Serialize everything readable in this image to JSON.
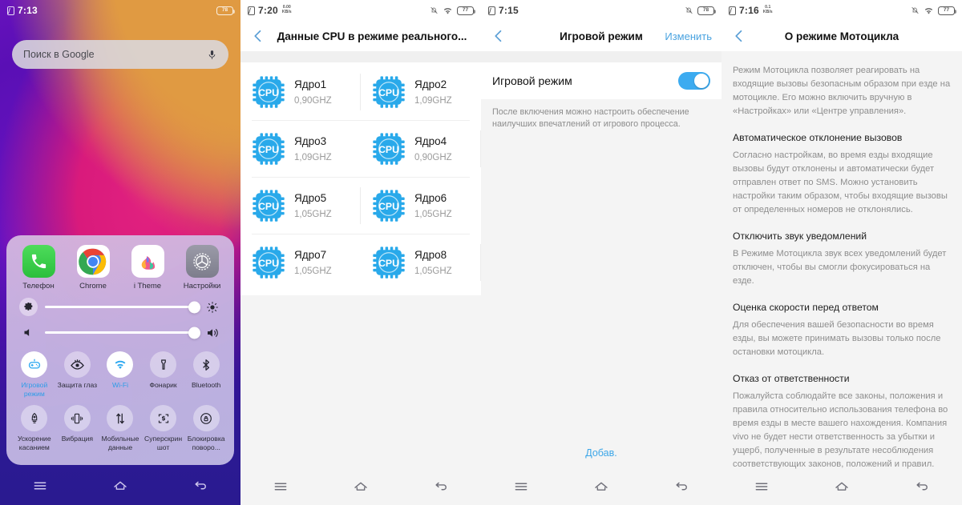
{
  "screens": {
    "home": {
      "status": {
        "time": "7:13",
        "battery": "78",
        "sim_icon": "sim-card-icon",
        "battery_icon": "battery-icon"
      },
      "search": {
        "placeholder": "Поиск в Google",
        "mic_icon": "microphone-icon"
      },
      "control_center": {
        "apps": [
          {
            "label": "Телефон",
            "icon": "phone-app-icon"
          },
          {
            "label": "Chrome",
            "icon": "chrome-app-icon"
          },
          {
            "label": "i Theme",
            "icon": "itheme-app-icon"
          },
          {
            "label": "Настройки",
            "icon": "settings-app-icon"
          }
        ],
        "brightness": {
          "left_icon": "gear-icon",
          "right_icon": "brightness-icon",
          "value": "95"
        },
        "volume": {
          "left_icon": "volume-low-icon",
          "right_icon": "volume-high-icon",
          "value": "95"
        },
        "tiles": [
          {
            "label": "Игровой режим",
            "icon": "game-mode-icon",
            "active": true
          },
          {
            "label": "Защита глаз",
            "icon": "eye-protection-icon",
            "active": false
          },
          {
            "label": "Wi-Fi",
            "icon": "wifi-icon",
            "active": true
          },
          {
            "label": "Фонарик",
            "icon": "flashlight-icon",
            "active": false
          },
          {
            "label": "Bluetooth",
            "icon": "bluetooth-icon",
            "active": false
          },
          {
            "label": "Ускорение касанием",
            "icon": "touch-boost-icon",
            "active": false
          },
          {
            "label": "Вибрация",
            "icon": "vibration-icon",
            "active": false
          },
          {
            "label": "Мобильные данные",
            "icon": "mobile-data-icon",
            "active": false
          },
          {
            "label": "Суперскриншот",
            "icon": "super-screenshot-icon",
            "active": false
          },
          {
            "label": "Блокировка поворо...",
            "icon": "rotation-lock-icon",
            "active": false
          }
        ]
      },
      "navbar": {
        "recents_icon": "menu-icon",
        "home_icon": "home-icon",
        "back_icon": "back-icon"
      }
    },
    "cpu": {
      "status": {
        "time": "7:20",
        "netspeed_value": "0.00",
        "netspeed_unit": "KB/s",
        "battery": "77"
      },
      "appbar": {
        "title": "Данные CPU в режиме реального...",
        "back_icon": "back-chevron-icon"
      },
      "cores": [
        {
          "name": "Ядро1",
          "freq": "0,90GHZ"
        },
        {
          "name": "Ядро2",
          "freq": "1,09GHZ"
        },
        {
          "name": "Ядро3",
          "freq": "1,09GHZ"
        },
        {
          "name": "Ядро4",
          "freq": "0,90GHZ"
        },
        {
          "name": "Ядро5",
          "freq": "1,05GHZ"
        },
        {
          "name": "Ядро6",
          "freq": "1,05GHZ"
        },
        {
          "name": "Ядро7",
          "freq": "1,05GHZ"
        },
        {
          "name": "Ядро8",
          "freq": "1,05GHZ"
        }
      ],
      "cpu_icon_text": "CPU"
    },
    "game": {
      "status": {
        "time": "7:15",
        "battery": "78"
      },
      "appbar": {
        "title": "Игровой режим",
        "action": "Изменить",
        "back_icon": "back-chevron-icon"
      },
      "toggle_row": {
        "label": "Игровой режим",
        "state": "on"
      },
      "description": "После включения можно настроить обеспечение наилучших впечатлений от игрового процесса.",
      "add_button": "Добав."
    },
    "moto": {
      "status": {
        "time": "7:16",
        "netspeed_value": "0.1",
        "netspeed_unit": "KB/s",
        "battery": "77"
      },
      "appbar": {
        "title": "О режиме Мотоцикла",
        "back_icon": "back-chevron-icon"
      },
      "intro": "Режим Мотоцикла позволяет реагировать на входящие вызовы безопасным образом при езде на мотоцикле. Его можно включить вручную в «Настройках» или «Центре управления».",
      "sections": [
        {
          "heading": "Автоматическое отклонение вызовов",
          "body": "Согласно настройкам, во время езды входящие вызовы будут отклонены и автоматически будет отправлен ответ по SMS. Можно установить настройки таким образом, чтобы входящие вызовы от определенных номеров не отклонялись."
        },
        {
          "heading": "Отключить звук уведомлений",
          "body": "В Режиме Мотоцикла звук всех уведомлений будет отключен, чтобы вы смогли фокусироваться на езде."
        },
        {
          "heading": "Оценка скорости перед ответом",
          "body": "Для обеспечения вашей безопасности во время езды, вы можете принимать вызовы только после остановки мотоцикла."
        },
        {
          "heading": "Отказ от ответственности",
          "body": "Пожалуйста соблюдайте все законы, положения и правила относительно использования телефона во время езды в месте вашего нахождения. Компания vivo не будет нести ответственность за убытки и ущерб, полученные в результате несоблюдения соответствующих законов, положений и правил. Для работы"
        }
      ]
    }
  },
  "colors": {
    "accent_blue": "#3ca6e8",
    "cpu_blue": "#29a9ea",
    "toggle_on": "#3cabf0",
    "light_bg": "#f4f4f4",
    "wallpaper_purple": "#6412bd",
    "wallpaper_magenta": "#d91a7c",
    "wallpaper_orange": "#dd9543"
  }
}
